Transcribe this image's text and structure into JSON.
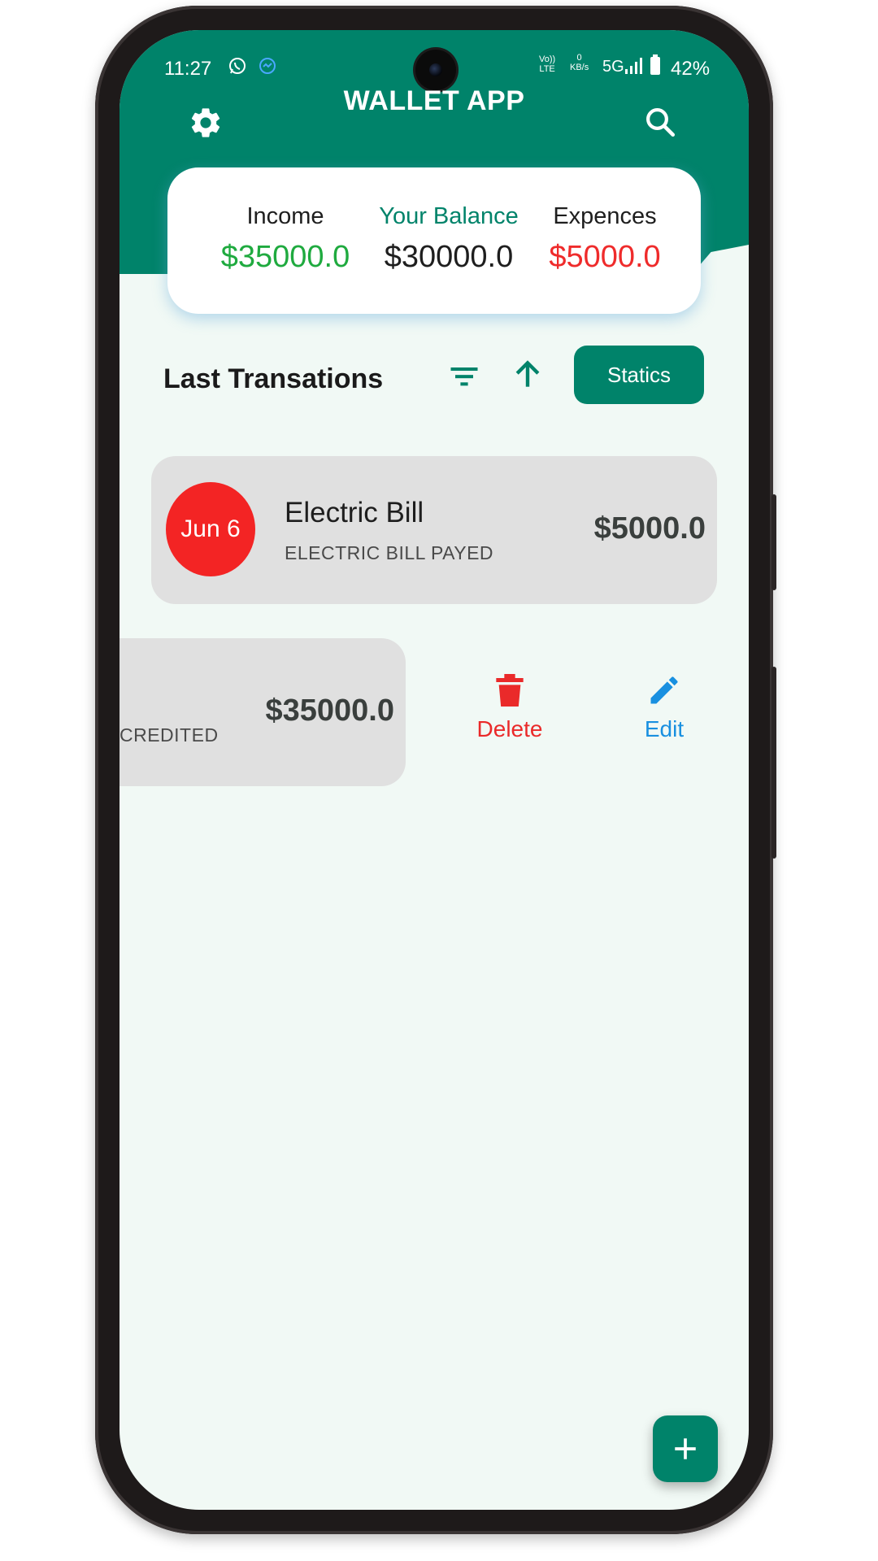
{
  "status_bar": {
    "time": "11:27",
    "network_top": "Vo))",
    "network_bottom": "LTE",
    "speed_value": "0",
    "speed_unit": "KB/s",
    "generation": "5G",
    "battery": "42%"
  },
  "header": {
    "title": "WALLET APP",
    "left_icon": "gear-icon",
    "right_icon": "search-icon"
  },
  "balance_card": {
    "income_label": "Income",
    "income_value": "$35000.0",
    "balance_label": "Your Balance",
    "balance_value": "$30000.0",
    "expense_label": "Expences",
    "expense_value": "$5000.0"
  },
  "transactions_header": {
    "title": "Last Transations",
    "statics_label": "Statics",
    "filter_icon": "filter-icon",
    "sort_icon": "arrow-up-icon"
  },
  "transactions": [
    {
      "date": "Jun 6",
      "name": "Electric Bill",
      "description": "ELECTRIC BILL PAYED",
      "amount": "$5000.0"
    },
    {
      "description": "CREDITED",
      "amount": "$35000.0"
    }
  ],
  "swipe_actions": {
    "delete_label": "Delete",
    "edit_label": "Edit"
  },
  "colors": {
    "primary": "#00836a",
    "income": "#1faa3f",
    "expense": "#ef2b2b",
    "edit": "#1990e0",
    "background": "#f1f9f5"
  },
  "fab_icon": "plus-icon"
}
